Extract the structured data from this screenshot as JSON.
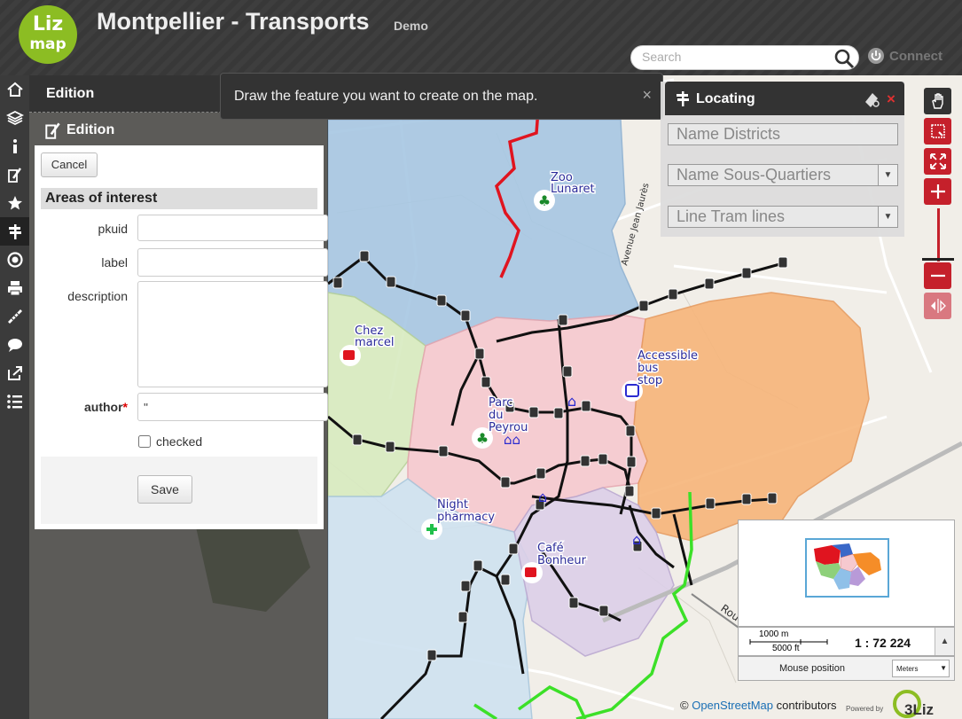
{
  "header": {
    "logo_line1": "Liz",
    "logo_line2": "map",
    "title": "Montpellier - Transports",
    "subtitle": "Demo",
    "search_placeholder": "Search",
    "connect_label": "Connect"
  },
  "toolbar": {
    "items": [
      "home-icon",
      "layers-icon",
      "info-icon",
      "edition-icon",
      "star-icon",
      "locating-icon",
      "target-icon",
      "print-icon",
      "measure-icon",
      "comment-icon",
      "share-icon",
      "list-icon"
    ],
    "active": "locating-icon"
  },
  "edition_dock": {
    "header": "Edition",
    "subtitle": "Edition",
    "cancel_label": "Cancel",
    "layer_title": "Areas of interest",
    "fields": {
      "pkuid_label": "pkuid",
      "pkuid_value": "",
      "label_label": "label",
      "label_value": "",
      "description_label": "description",
      "description_value": "",
      "author_label": "author",
      "author_required": "*",
      "author_value": "''",
      "checked_label": "checked",
      "checked_value": false
    },
    "save_label": "Save"
  },
  "message": {
    "text": "Draw the feature you want to create on the map.",
    "close": "×"
  },
  "locating": {
    "title": "Locating",
    "close": "×",
    "selects": [
      "Name Districts",
      "Name Sous-Quartiers",
      "Line Tram lines"
    ]
  },
  "map": {
    "pois": [
      "Zoo Lunaret",
      "Chez marcel",
      "Accessible bus stop",
      "Parc du Peyrou",
      "Night pharmacy",
      "Café Bonheur"
    ],
    "street_label": "Avenue Jean Jaurès",
    "street_label2": "Rou",
    "colors": {
      "district_blue": "#a7c7e3",
      "district_pink": "#f6c9cf",
      "district_orange": "#f7b57a",
      "district_green": "#d8ebc0",
      "district_lightblue": "#cfe2f0",
      "district_purple": "#dcd0e8",
      "tram_red": "#e0141f",
      "tram_green": "#3ce028",
      "accent_red": "#c5202b"
    }
  },
  "scale": {
    "bar_m": "1000 m",
    "bar_ft": "5000 ft",
    "value": "1 : 72 224"
  },
  "mouse_position": {
    "label": "Mouse position",
    "unit": "Meters"
  },
  "attribution": {
    "prefix": "©",
    "link": "OpenStreetMap",
    "suffix": "contributors"
  },
  "powered_by": {
    "label": "Powered by",
    "brand": "3Liz"
  }
}
